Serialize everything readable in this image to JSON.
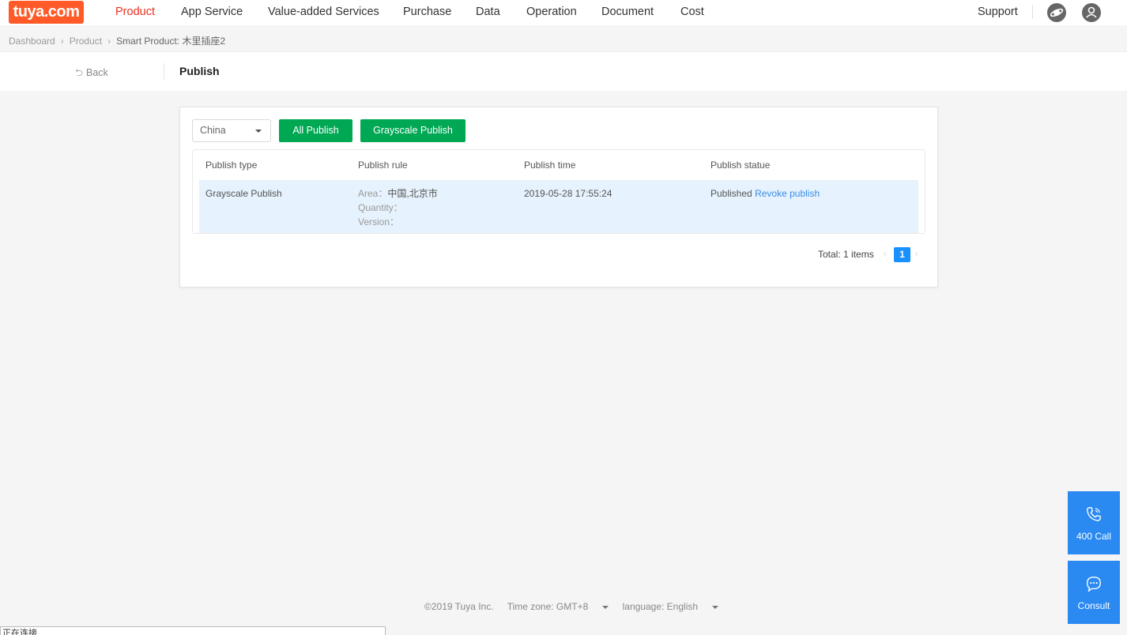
{
  "nav": {
    "logo": "tuya.com",
    "items": [
      "Product",
      "App Service",
      "Value-added Services",
      "Purchase",
      "Data",
      "Operation",
      "Document",
      "Cost"
    ],
    "support": "Support"
  },
  "breadcrumb": [
    "Dashboard",
    "Product",
    "Smart Product: 木里插座2"
  ],
  "subheader": {
    "back": "Back",
    "title": "Publish"
  },
  "filters": {
    "region": "China",
    "all_publish": "All Publish",
    "grayscale_publish": "Grayscale Publish"
  },
  "table": {
    "headers": [
      "Publish type",
      "Publish rule",
      "Publish time",
      "Publish statue"
    ],
    "rows": [
      {
        "type": "Grayscale Publish",
        "area_label": "Area：",
        "area_value": "中国,北京市",
        "quantity_label": "Quantity：",
        "version_label": "Version：",
        "time": "2019-05-28 17:55:24",
        "status": "Published",
        "action": "Revoke publish"
      }
    ]
  },
  "pagination": {
    "total": "Total: 1 items",
    "current": "1",
    "prev": "‹",
    "next": "›"
  },
  "footer": {
    "copyright": "©2019 Tuya Inc.",
    "timezone": "Time zone:  GMT+8",
    "language": "language: English"
  },
  "float_buttons": {
    "call": "400 Call",
    "consult": "Consult"
  },
  "statusbar": "正在连接",
  "colors": {
    "brand": "#ff5a28",
    "active_nav": "#e8301d",
    "green": "#00a854",
    "blue": "#1890ff",
    "float": "#2a8af2"
  }
}
